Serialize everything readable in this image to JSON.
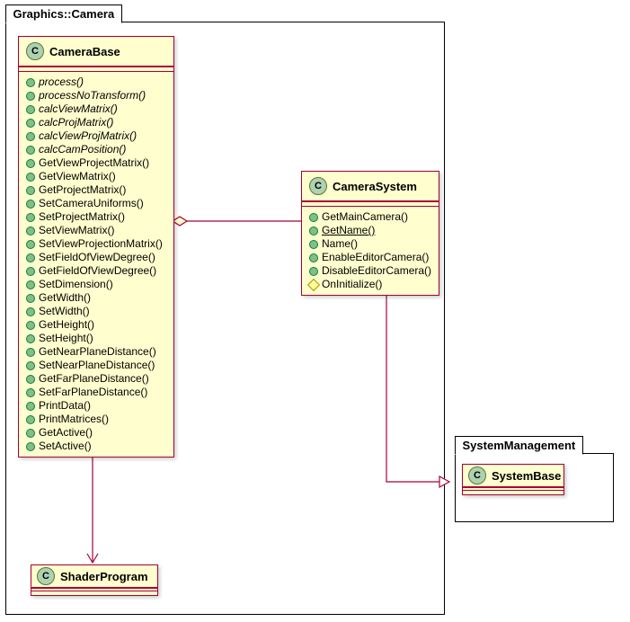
{
  "packages": {
    "camera": {
      "label": "Graphics::Camera"
    },
    "sysmgmt": {
      "label": "SystemManagement"
    }
  },
  "classes": {
    "cameraBase": {
      "name": "CameraBase",
      "members": [
        {
          "vis": "public",
          "label": "process()",
          "italic": true
        },
        {
          "vis": "public",
          "label": "processNoTransform()",
          "italic": true
        },
        {
          "vis": "public",
          "label": "calcViewMatrix()",
          "italic": true
        },
        {
          "vis": "public",
          "label": "calcProjMatrix()",
          "italic": true
        },
        {
          "vis": "public",
          "label": "calcViewProjMatrix()",
          "italic": true
        },
        {
          "vis": "public",
          "label": "calcCamPosition()",
          "italic": true
        },
        {
          "vis": "public",
          "label": "GetViewProjectMatrix()"
        },
        {
          "vis": "public",
          "label": "GetViewMatrix()"
        },
        {
          "vis": "public",
          "label": "GetProjectMatrix()"
        },
        {
          "vis": "public",
          "label": "SetCameraUniforms()"
        },
        {
          "vis": "public",
          "label": "SetProjectMatrix()"
        },
        {
          "vis": "public",
          "label": "SetViewMatrix()"
        },
        {
          "vis": "public",
          "label": "SetViewProjectionMatrix()"
        },
        {
          "vis": "public",
          "label": "SetFieldOfViewDegree()"
        },
        {
          "vis": "public",
          "label": "GetFieldOfViewDegree()"
        },
        {
          "vis": "public",
          "label": "SetDimension()"
        },
        {
          "vis": "public",
          "label": "GetWidth()"
        },
        {
          "vis": "public",
          "label": "SetWidth()"
        },
        {
          "vis": "public",
          "label": "GetHeight()"
        },
        {
          "vis": "public",
          "label": "SetHeight()"
        },
        {
          "vis": "public",
          "label": "GetNearPlaneDistance()"
        },
        {
          "vis": "public",
          "label": "SetNearPlaneDistance()"
        },
        {
          "vis": "public",
          "label": "GetFarPlaneDistance()"
        },
        {
          "vis": "public",
          "label": "SetFarPlaneDistance()"
        },
        {
          "vis": "public",
          "label": "PrintData()"
        },
        {
          "vis": "public",
          "label": "PrintMatrices()"
        },
        {
          "vis": "public",
          "label": "GetActive()"
        },
        {
          "vis": "public",
          "label": "SetActive()"
        }
      ]
    },
    "cameraSystem": {
      "name": "CameraSystem",
      "members": [
        {
          "vis": "public",
          "label": "GetMainCamera()"
        },
        {
          "vis": "public",
          "label": "GetName()",
          "underline": true
        },
        {
          "vis": "public",
          "label": "Name()"
        },
        {
          "vis": "public",
          "label": "EnableEditorCamera()"
        },
        {
          "vis": "public",
          "label": "DisableEditorCamera()"
        },
        {
          "vis": "protected",
          "label": "OnInitialize()"
        }
      ]
    },
    "shaderProgram": {
      "name": "ShaderProgram"
    },
    "systemBase": {
      "name": "SystemBase"
    }
  },
  "chart_data": {
    "type": "uml-class-diagram",
    "packages": [
      {
        "name": "Graphics::Camera",
        "classes": [
          "CameraBase",
          "CameraSystem",
          "ShaderProgram"
        ]
      },
      {
        "name": "SystemManagement",
        "classes": [
          "SystemBase"
        ]
      }
    ],
    "classes": [
      {
        "name": "CameraBase",
        "stereotype": "C",
        "methods": [
          {
            "visibility": "public",
            "name": "process()",
            "abstract": true
          },
          {
            "visibility": "public",
            "name": "processNoTransform()",
            "abstract": true
          },
          {
            "visibility": "public",
            "name": "calcViewMatrix()",
            "abstract": true
          },
          {
            "visibility": "public",
            "name": "calcProjMatrix()",
            "abstract": true
          },
          {
            "visibility": "public",
            "name": "calcViewProjMatrix()",
            "abstract": true
          },
          {
            "visibility": "public",
            "name": "calcCamPosition()",
            "abstract": true
          },
          {
            "visibility": "public",
            "name": "GetViewProjectMatrix()"
          },
          {
            "visibility": "public",
            "name": "GetViewMatrix()"
          },
          {
            "visibility": "public",
            "name": "GetProjectMatrix()"
          },
          {
            "visibility": "public",
            "name": "SetCameraUniforms()"
          },
          {
            "visibility": "public",
            "name": "SetProjectMatrix()"
          },
          {
            "visibility": "public",
            "name": "SetViewMatrix()"
          },
          {
            "visibility": "public",
            "name": "SetViewProjectionMatrix()"
          },
          {
            "visibility": "public",
            "name": "SetFieldOfViewDegree()"
          },
          {
            "visibility": "public",
            "name": "GetFieldOfViewDegree()"
          },
          {
            "visibility": "public",
            "name": "SetDimension()"
          },
          {
            "visibility": "public",
            "name": "GetWidth()"
          },
          {
            "visibility": "public",
            "name": "SetWidth()"
          },
          {
            "visibility": "public",
            "name": "GetHeight()"
          },
          {
            "visibility": "public",
            "name": "SetHeight()"
          },
          {
            "visibility": "public",
            "name": "GetNearPlaneDistance()"
          },
          {
            "visibility": "public",
            "name": "SetNearPlaneDistance()"
          },
          {
            "visibility": "public",
            "name": "GetFarPlaneDistance()"
          },
          {
            "visibility": "public",
            "name": "SetFarPlaneDistance()"
          },
          {
            "visibility": "public",
            "name": "PrintData()"
          },
          {
            "visibility": "public",
            "name": "PrintMatrices()"
          },
          {
            "visibility": "public",
            "name": "GetActive()"
          },
          {
            "visibility": "public",
            "name": "SetActive()"
          }
        ]
      },
      {
        "name": "CameraSystem",
        "stereotype": "C",
        "methods": [
          {
            "visibility": "public",
            "name": "GetMainCamera()"
          },
          {
            "visibility": "public",
            "name": "GetName()",
            "static": true
          },
          {
            "visibility": "public",
            "name": "Name()"
          },
          {
            "visibility": "public",
            "name": "EnableEditorCamera()"
          },
          {
            "visibility": "public",
            "name": "DisableEditorCamera()"
          },
          {
            "visibility": "protected",
            "name": "OnInitialize()"
          }
        ]
      },
      {
        "name": "ShaderProgram",
        "stereotype": "C"
      },
      {
        "name": "SystemBase",
        "stereotype": "C"
      }
    ],
    "relations": [
      {
        "from": "CameraSystem",
        "to": "CameraBase",
        "type": "aggregation"
      },
      {
        "from": "CameraBase",
        "to": "ShaderProgram",
        "type": "association-directed"
      },
      {
        "from": "CameraSystem",
        "to": "SystemBase",
        "type": "generalization"
      }
    ]
  }
}
